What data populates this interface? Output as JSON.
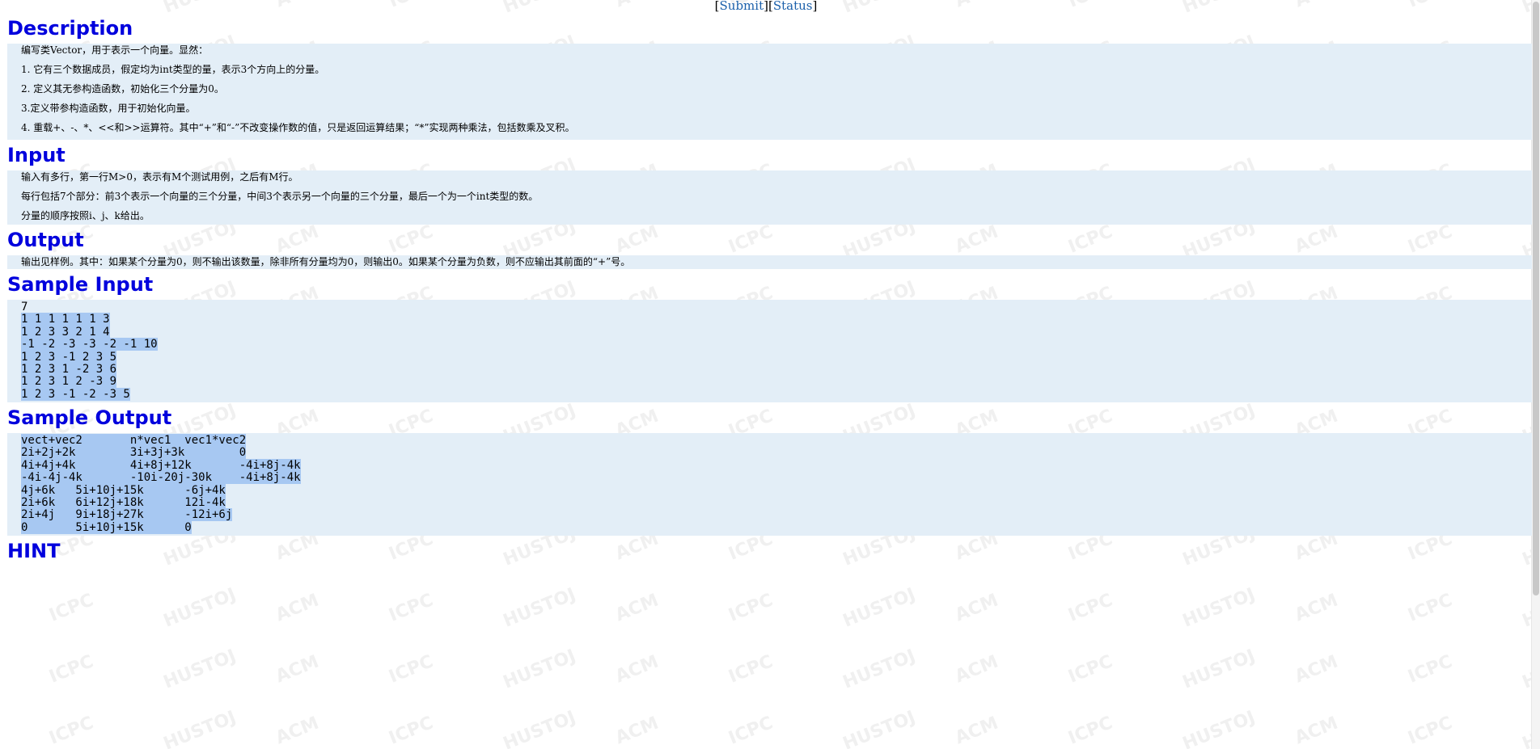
{
  "nav": {
    "open_bracket": "[",
    "submit": "Submit",
    "middle": "][",
    "status": "Status",
    "close_bracket": "]"
  },
  "watermark": {
    "texts": [
      "HUSTOJ",
      "ACM",
      "ICPC"
    ]
  },
  "description": {
    "title": "Description",
    "lines": [
      "编写类Vector，用于表示一个向量。显然：",
      "1. 它有三个数据成员，假定均为int类型的量，表示3个方向上的分量。",
      "2. 定义其无参构造函数，初始化三个分量为0。",
      "3.定义带参构造函数，用于初始化向量。",
      "4. 重载+、-、*、<<和>>运算符。其中“+”和“-”不改变操作数的值，只是返回运算结果；“*”实现两种乘法，包括数乘及叉积。"
    ]
  },
  "input": {
    "title": "Input",
    "lines": [
      "输入有多行，第一行M>0，表示有M个测试用例，之后有M行。",
      "每行包括7个部分：前3个表示一个向量的三个分量，中间3个表示另一个向量的三个分量，最后一个为一个int类型的数。",
      "分量的顺序按照i、j、k给出。"
    ]
  },
  "output": {
    "title": "Output",
    "lines": [
      "输出见样例。其中：如果某个分量为0，则不输出该数量，除非所有分量均为0，则输出0。如果某个分量为负数，则不应输出其前面的“+”号。"
    ]
  },
  "sample_input": {
    "title": "Sample Input",
    "first_line": "7",
    "lines": [
      "1 1 1 1 1 1 3",
      "1 2 3 3 2 1 4",
      "-1 -2 -3 -3 -2 -1 10",
      "1 2 3 -1 2 3 5",
      "1 2 3 1 -2 3 6",
      "1 2 3 1 2 -3 9",
      "1 2 3 -1 -2 -3 5"
    ]
  },
  "sample_output": {
    "title": "Sample Output",
    "lines": [
      "vect+vec2       n*vec1  vec1*vec2",
      "2i+2j+2k        3i+3j+3k        0",
      "4i+4j+4k        4i+8j+12k       -4i+8j-4k",
      "-4i-4j-4k       -10i-20j-30k    -4i+8j-4k",
      "4j+6k   5i+10j+15k      -6j+4k",
      "2i+6k   6i+12j+18k      12i-4k",
      "2i+4j   9i+18j+27k      -12i+6j",
      "0       5i+10j+15k      0"
    ]
  },
  "hint": {
    "title": "HINT"
  }
}
